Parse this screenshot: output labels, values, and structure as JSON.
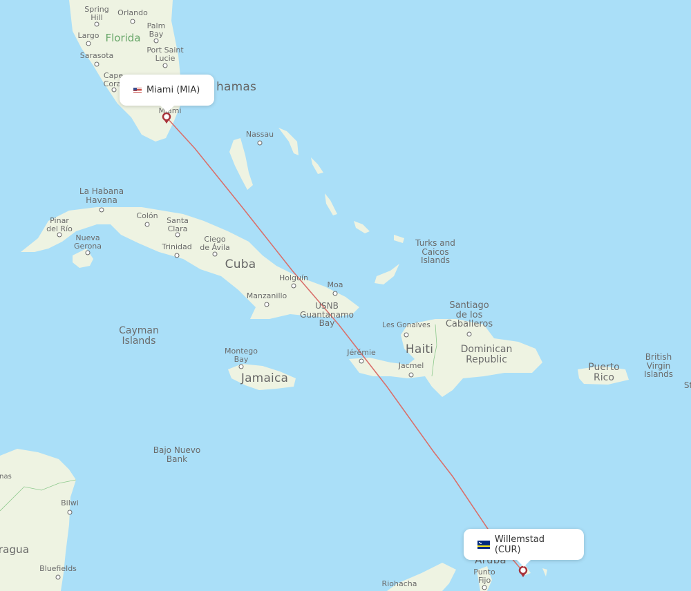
{
  "map": {
    "colors": {
      "water": "#aadff8",
      "land": "#eef3e2",
      "route": "#d9706b",
      "pin": "#a8323a",
      "border": "#8cc98c"
    },
    "route": {
      "origin": {
        "city": "Miami",
        "code": "MIA",
        "label": "Miami (MIA)",
        "flag": "us-flag-icon"
      },
      "destination": {
        "city": "Willemstad",
        "code": "CUR",
        "label": "Willemstad (CUR)",
        "flag": "curacao-flag-icon"
      }
    },
    "labels": {
      "florida": "Florida",
      "bahamas": "Bahamas",
      "bahamas_visible": "hamas",
      "cuba": "Cuba",
      "jamaica": "Jamaica",
      "haiti": "Haiti",
      "dominican_republic": "Dominican\nRepublic",
      "puerto_rico": "Puerto\nRico",
      "cayman_islands": "Cayman\nIslands",
      "aruba": "Aruba",
      "nicaragua_partial": "ragua",
      "turks_caicos": "Turks and\nCaicos\nIslands",
      "british_virgin_islands": "British\nVirgin\nIslands",
      "bajo_nuevo_bank": "Bajo Nuevo\nBank",
      "usnb": "USNB\nGuantanamo\nBay",
      "st_partial": "St",
      "honduras_partial": "nas"
    },
    "cities": [
      {
        "name": "Spring\nHill"
      },
      {
        "name": "Orlando"
      },
      {
        "name": "Palm\nBay"
      },
      {
        "name": "Largo"
      },
      {
        "name": "Port Saint\nLucie"
      },
      {
        "name": "Sarasota"
      },
      {
        "name": "Cape\nCoral"
      },
      {
        "name": "Miami"
      },
      {
        "name": "Nassau"
      },
      {
        "name": "La Habana\nHavana"
      },
      {
        "name": "Pinar\ndel Río"
      },
      {
        "name": "Colón"
      },
      {
        "name": "Santa\nClara"
      },
      {
        "name": "Nueva\nGerona"
      },
      {
        "name": "Trinidad"
      },
      {
        "name": "Ciego\nde Ávila"
      },
      {
        "name": "Holguín"
      },
      {
        "name": "Moa"
      },
      {
        "name": "Manzanillo"
      },
      {
        "name": "Montego\nBay"
      },
      {
        "name": "Jérémie"
      },
      {
        "name": "Les Gonaïves"
      },
      {
        "name": "Jacmel"
      },
      {
        "name": "Santiago\nde los\nCaballeros"
      },
      {
        "name": "Bilwi"
      },
      {
        "name": "Bluefields"
      },
      {
        "name": "Riohacha"
      },
      {
        "name": "Punto\nFijo"
      }
    ]
  }
}
